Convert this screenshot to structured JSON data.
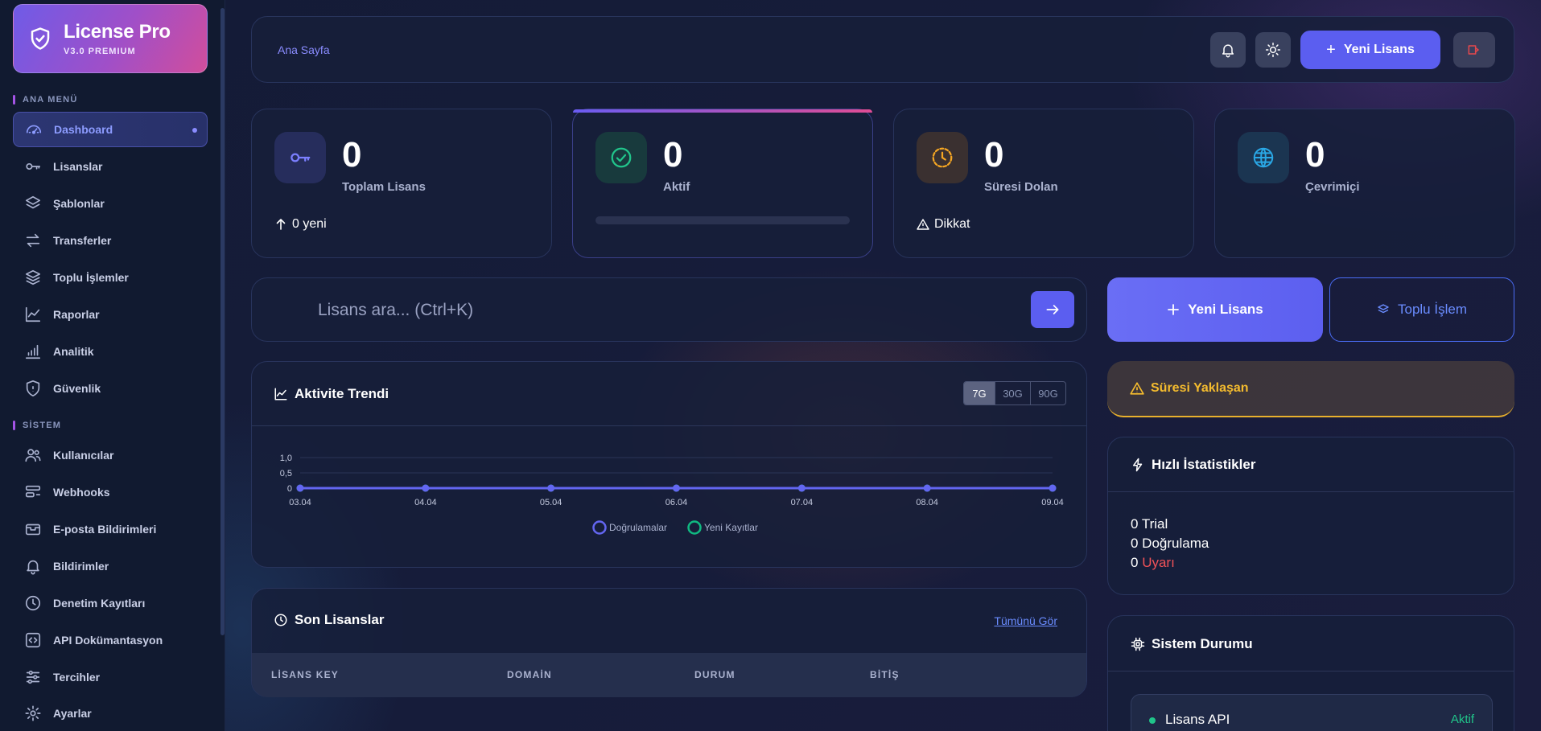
{
  "brand": {
    "title": "License Pro",
    "subtitle": "V3.0 PREMIUM"
  },
  "sidebar": {
    "section_main": "ANA MENÜ",
    "section_system": "SİSTEM",
    "main_items": [
      {
        "label": "Dashboard",
        "icon": "gauge-icon",
        "active": true
      },
      {
        "label": "Lisanslar",
        "icon": "key-icon"
      },
      {
        "label": "Şablonlar",
        "icon": "layers-icon"
      },
      {
        "label": "Transferler",
        "icon": "transfer-icon"
      },
      {
        "label": "Toplu İşlemler",
        "icon": "stack-icon"
      },
      {
        "label": "Raporlar",
        "icon": "trend-icon"
      },
      {
        "label": "Analitik",
        "icon": "bars-icon"
      },
      {
        "label": "Güvenlik",
        "icon": "shield-icon"
      }
    ],
    "system_items": [
      {
        "label": "Kullanıcılar",
        "icon": "users-icon"
      },
      {
        "label": "Webhooks",
        "icon": "webhook-icon"
      },
      {
        "label": "E-posta Bildirimleri",
        "icon": "mail-icon"
      },
      {
        "label": "Bildirimler",
        "icon": "bell-icon"
      },
      {
        "label": "Denetim Kayıtları",
        "icon": "clock-icon"
      },
      {
        "label": "API Dokümantasyon",
        "icon": "code-icon"
      },
      {
        "label": "Tercihler",
        "icon": "sliders-icon"
      },
      {
        "label": "Ayarlar",
        "icon": "gear-icon"
      }
    ]
  },
  "topbar": {
    "breadcrumb": "Ana Sayfa",
    "new_license": "Yeni Lisans"
  },
  "stats": [
    {
      "value": "0",
      "label": "Toplam Lisans",
      "footer": "0 yeni",
      "color": "#7b7fff"
    },
    {
      "value": "0",
      "label": "Aktif",
      "color": "#21c58b"
    },
    {
      "value": "0",
      "label": "Süresi Dolan",
      "footer": "Dikkat",
      "color": "#f5a623"
    },
    {
      "value": "0",
      "label": "Çevrimiçi",
      "color": "#2aa8e6"
    }
  ],
  "search": {
    "placeholder": "Lisans ara... (Ctrl+K)"
  },
  "actions": {
    "new_license": "Yeni Lisans",
    "bulk": "Toplu İşlem"
  },
  "chart_panel": {
    "title": "Aktivite Trendi",
    "ranges": [
      "7G",
      "30G",
      "90G"
    ],
    "active_range": "7G"
  },
  "chart_data": {
    "type": "line",
    "x": [
      "03.04",
      "04.04",
      "05.04",
      "06.04",
      "07.04",
      "08.04",
      "09.04"
    ],
    "series": [
      {
        "name": "Doğrulamalar",
        "values": [
          0,
          0,
          0,
          0,
          0,
          0,
          0
        ],
        "color": "#6366f1"
      },
      {
        "name": "Yeni Kayıtlar",
        "values": [
          0,
          0,
          0,
          0,
          0,
          0,
          0
        ],
        "color": "#10b981"
      }
    ],
    "yticks": [
      "1,0",
      "0,5",
      "0"
    ],
    "ylim": [
      0,
      1
    ],
    "legend": "bottom-center",
    "grid": true
  },
  "recent": {
    "title": "Son Lisanslar",
    "see_all": "Tümünü Gör",
    "columns": [
      "LİSANS KEY",
      "DOMAİN",
      "DURUM",
      "BİTİŞ"
    ]
  },
  "expiring": {
    "title": "Süresi Yaklaşan"
  },
  "quick_stats": {
    "title": "Hızlı İstatistikler",
    "trial": "0 Trial",
    "verify": "0 Doğrulama",
    "warn_count": "0",
    "warn_label": "Uyarı"
  },
  "system": {
    "title": "Sistem Durumu",
    "service_name": "Lisans API",
    "service_status": "Aktif"
  }
}
